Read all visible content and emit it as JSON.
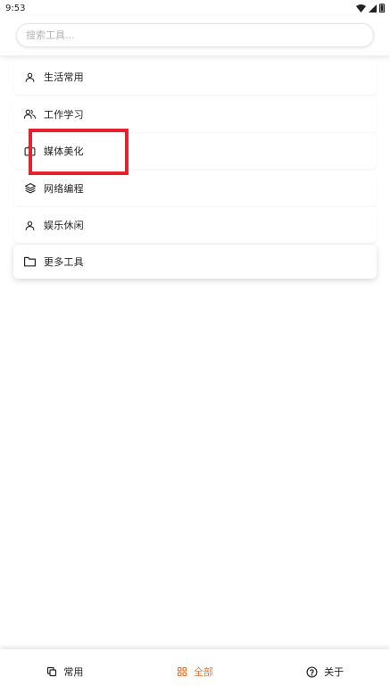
{
  "status_bar": {
    "time": "9:53"
  },
  "search": {
    "placeholder": "搜索工具..."
  },
  "categories": [
    {
      "label": "生活常用",
      "icon": "person-icon"
    },
    {
      "label": "工作学习",
      "icon": "users-icon"
    },
    {
      "label": "媒体美化",
      "icon": "camera-icon"
    },
    {
      "label": "网络编程",
      "icon": "layers-icon"
    },
    {
      "label": "娱乐休闲",
      "icon": "person-icon"
    },
    {
      "label": "更多工具",
      "icon": "folder-icon"
    }
  ],
  "bottom_nav": {
    "items": [
      {
        "label": "常用",
        "icon": "copy-icon",
        "active": false
      },
      {
        "label": "全部",
        "icon": "grid-icon",
        "active": true
      },
      {
        "label": "关于",
        "icon": "help-circle-icon",
        "active": false
      }
    ]
  },
  "colors": {
    "accent": "#e8772e",
    "highlight": "#e8212e"
  }
}
